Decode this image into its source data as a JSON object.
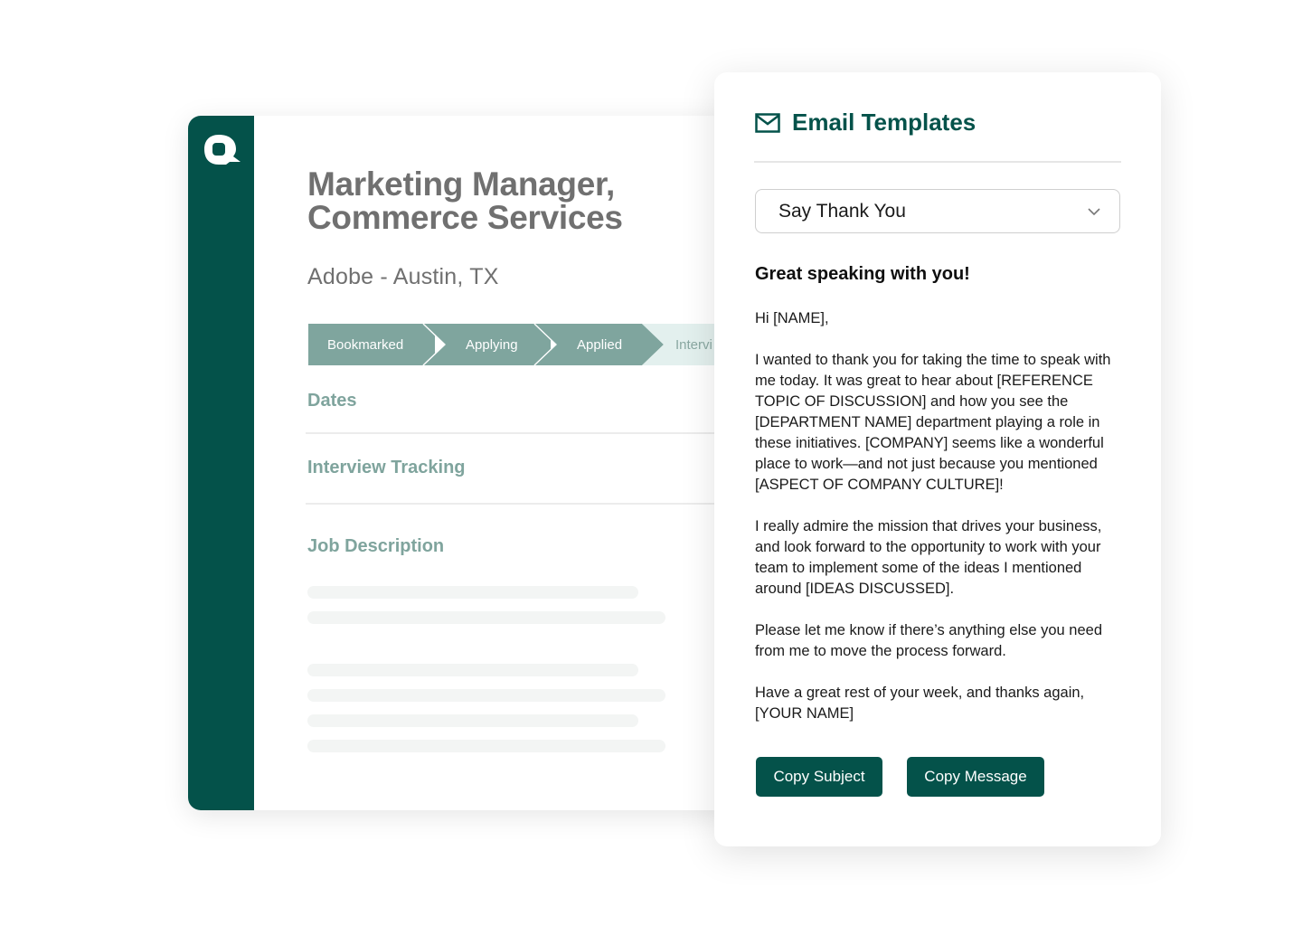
{
  "job": {
    "title_line1": "Marketing Manager,",
    "title_line2": "Commerce Services",
    "company_location": "Adobe - Austin, TX",
    "stages": [
      "Bookmarked",
      "Applying",
      "Applied",
      "Intervi"
    ],
    "sections": {
      "dates": "Dates",
      "interview_tracking": "Interview Tracking",
      "job_description": "Job Description"
    }
  },
  "email": {
    "header_title": "Email Templates",
    "icon": "envelope-icon",
    "template_selected": "Say Thank You",
    "subject": "Great speaking with you!",
    "paragraphs": [
      "Hi [NAME],",
      "I wanted to thank you for taking the time to speak with me today. It was great to hear about [REFERENCE TOPIC OF DISCUSSION] and how you see the [DEPARTMENT NAME] department playing a role in these initiatives. [COMPANY] seems like a wonderful place to work—and not just because you mentioned [ASPECT OF COMPANY CULTURE]!",
      "I really admire the mission that drives your business, and look forward to the opportunity to work with your team to implement some of the ideas I mentioned around [IDEAS DISCUSSED].",
      "Please let me know if there’s anything else you need from me to move the process forward.",
      "Have a great rest of your week, and thanks again, [YOUR NAME]"
    ],
    "buttons": {
      "copy_subject": "Copy Subject",
      "copy_message": "Copy Message"
    }
  },
  "colors": {
    "brand": "#04524a",
    "stage_active": "#7fa59e",
    "stage_inactive": "#e3f0ee",
    "section_heading": "#7fa49d"
  }
}
